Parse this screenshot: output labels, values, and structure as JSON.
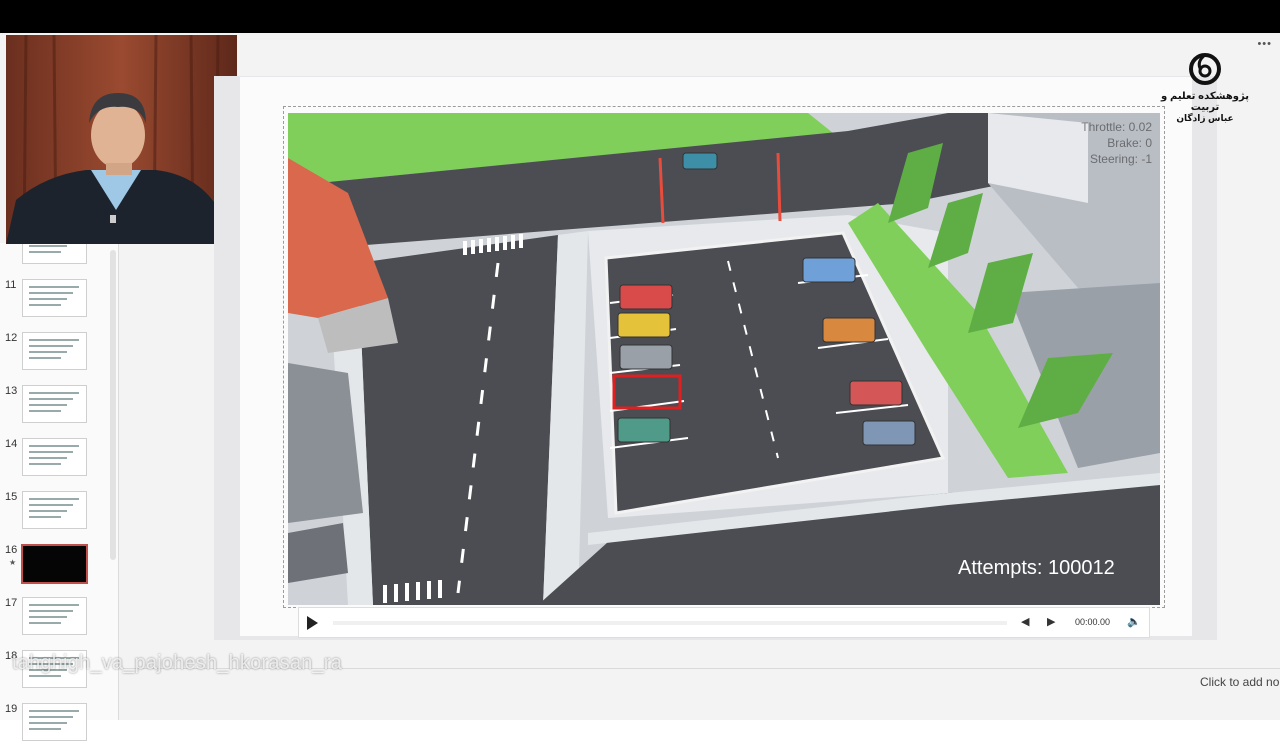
{
  "slide_panel": {
    "thumbnails": [
      {
        "number": "",
        "selected": false
      },
      {
        "number": "11",
        "selected": false
      },
      {
        "number": "12",
        "selected": false
      },
      {
        "number": "13",
        "selected": false
      },
      {
        "number": "14",
        "selected": false
      },
      {
        "number": "15",
        "selected": false
      },
      {
        "number": "16",
        "selected": true,
        "has_animation_marker": true
      },
      {
        "number": "17",
        "selected": false
      },
      {
        "number": "18",
        "selected": false
      },
      {
        "number": "19",
        "selected": false
      }
    ]
  },
  "logo": {
    "icon": "institute-logo-icon",
    "line1": "پژوهشکده تعلیم و تربیت",
    "line2": "عباس زادگان"
  },
  "video": {
    "hud": {
      "throttle": "Throttle: 0.02",
      "brake": "Brake: 0",
      "steering": "Steering: -1"
    },
    "attempts": "Attempts: 100012",
    "car_colors": [
      "#d94a4a",
      "#e4c23a",
      "#9aa0a8",
      "#4f9a88",
      "#6fa0d8",
      "#d98840",
      "#d45656",
      "#7f97b4",
      "#3c8fa6"
    ]
  },
  "player": {
    "play_icon": "play-icon",
    "back_icon": "step-back-icon",
    "forward_icon": "step-forward-icon",
    "volume_icon": "volume-icon",
    "time": "00:00.00"
  },
  "watermark": "tahghigh_va_pajohesh_hkorasan_ra",
  "notes_placeholder": "Click to add no",
  "colors": {
    "selection_border": "#c0504d",
    "grass": "#7fcf5a",
    "asphalt": "#4b4d52"
  }
}
